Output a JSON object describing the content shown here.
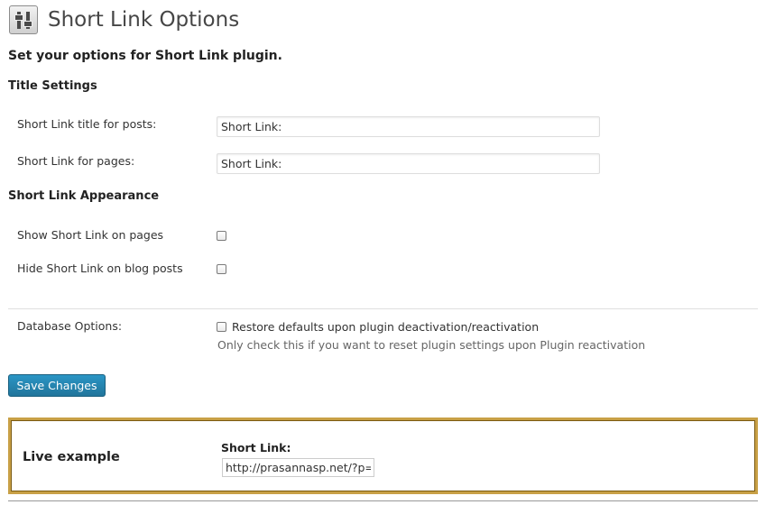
{
  "header": {
    "title": "Short Link Options",
    "icon": "settings-sliders-icon"
  },
  "intro_text": "Set your options for Short Link plugin.",
  "title_settings": {
    "heading": "Title Settings",
    "posts_label": "Short Link title for posts:",
    "posts_value": "Short Link:",
    "pages_label": "Short Link for pages:",
    "pages_value": "Short Link:"
  },
  "appearance": {
    "heading": "Short Link Appearance",
    "show_on_pages_label": "Show Short Link on pages",
    "show_on_pages_checked": false,
    "hide_on_posts_label": "Hide Short Link on blog posts",
    "hide_on_posts_checked": false
  },
  "database": {
    "label": "Database Options:",
    "restore_label": "Restore defaults upon plugin deactivation/reactivation",
    "restore_checked": false,
    "description": "Only check this if you want to reset plugin settings upon Plugin reactivation"
  },
  "save_button": "Save Changes",
  "live_example": {
    "heading": "Live example",
    "label": "Short Link:",
    "url_value": "http://prasannasp.net/?p="
  },
  "colors": {
    "primary_button": "#21759b",
    "example_border": "#c8a046"
  }
}
